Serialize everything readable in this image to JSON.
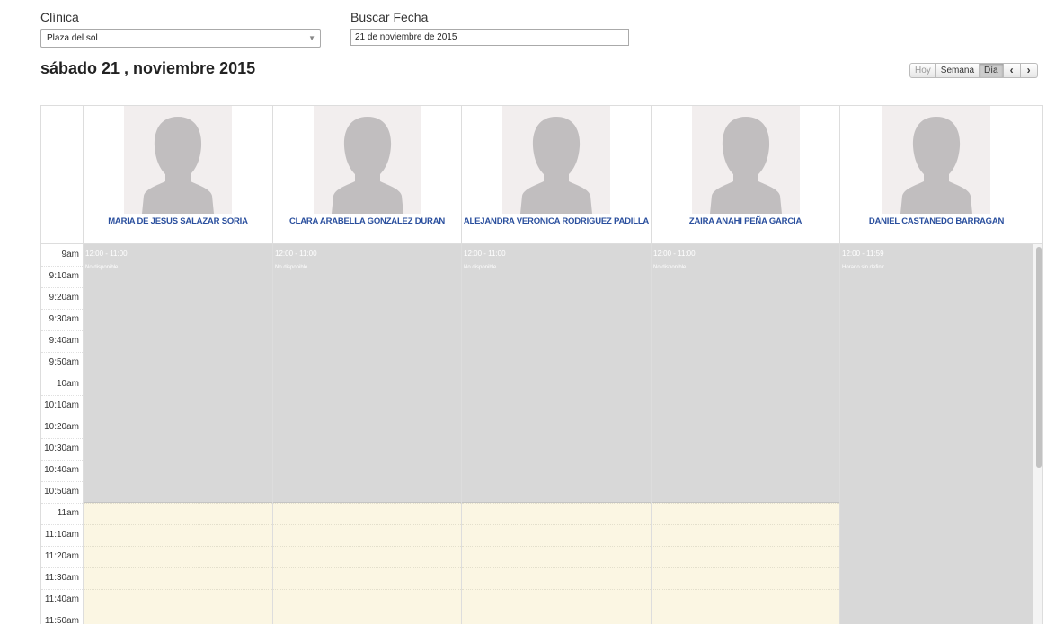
{
  "filters": {
    "clinic_label": "Clínica",
    "clinic_value": "Plaza del sol",
    "date_label": "Buscar Fecha",
    "date_value": "21 de noviembre de 2015"
  },
  "title": "sábado 21 , noviembre 2015",
  "view_buttons": {
    "today": "Hoy",
    "week": "Semana",
    "day": "Día",
    "prev": "‹",
    "next": "›",
    "active": "day"
  },
  "times": [
    "9am",
    "9:10am",
    "9:20am",
    "9:30am",
    "9:40am",
    "9:50am",
    "10am",
    "10:10am",
    "10:20am",
    "10:30am",
    "10:40am",
    "10:50am",
    "11am",
    "11:10am",
    "11:20am",
    "11:30am",
    "11:40am",
    "11:50am"
  ],
  "doctors": [
    {
      "name": "MARIA DE JESUS SALAZAR SORIA",
      "avatar_icon": "person-silhouette-icon",
      "event": {
        "time": "12:00 - 11:00",
        "title": "No disponible",
        "slots": 12
      }
    },
    {
      "name": "CLARA ARABELLA GONZALEZ DURAN",
      "avatar_icon": "person-silhouette-icon",
      "event": {
        "time": "12:00 - 11:00",
        "title": "No disponible",
        "slots": 12
      }
    },
    {
      "name": "ALEJANDRA VERONICA RODRIGUEZ PADILLA",
      "avatar_icon": "person-silhouette-icon",
      "event": {
        "time": "12:00 - 11:00",
        "title": "No disponible",
        "slots": 12
      }
    },
    {
      "name": "ZAIRA ANAHI PEÑA GARCIA",
      "avatar_icon": "person-silhouette-icon",
      "event": {
        "time": "12:00 - 11:00",
        "title": "No disponible",
        "slots": 12
      }
    },
    {
      "name": "DANIEL CASTANEDO BARRAGAN",
      "avatar_icon": "person-silhouette-icon",
      "event": {
        "time": "12:00 - 11:59",
        "title": "Horario sin definir",
        "slots": 18
      }
    }
  ],
  "colors": {
    "name_link": "#2a4f9e",
    "unavailable": "#d8d8d8",
    "free_slot": "#fbf6e3",
    "avatar_bg": "#f2eeee",
    "avatar_silhouette": "#c1bebf"
  }
}
